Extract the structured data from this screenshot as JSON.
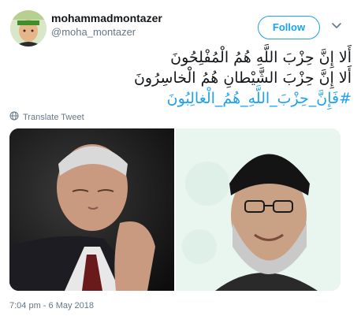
{
  "user": {
    "display_name": "mohammadmontazer",
    "handle": "@moha_montazer"
  },
  "actions": {
    "follow_label": "Follow"
  },
  "tweet": {
    "lines": [
      "أَلا إِنَّ حِزْبَ اللَّهِ هُمُ الْمُفْلِحُونَ",
      "أَلا إِنَّ حِزْبَ الشَّيْطانِ هُمُ الْخاسِرُونَ"
    ],
    "hashtag": "#فَإِنَّ_حِزْبَ_اللَّهِ_هُمُ_الْغالِبُونَ"
  },
  "translate_label": "Translate Tweet",
  "timestamp": "7:04 pm - 6 May 2018",
  "colors": {
    "accent": "#1da1f2",
    "secondary_text": "#657786"
  },
  "icons": {
    "translate": "globe-icon",
    "more": "chevron-down-icon"
  }
}
